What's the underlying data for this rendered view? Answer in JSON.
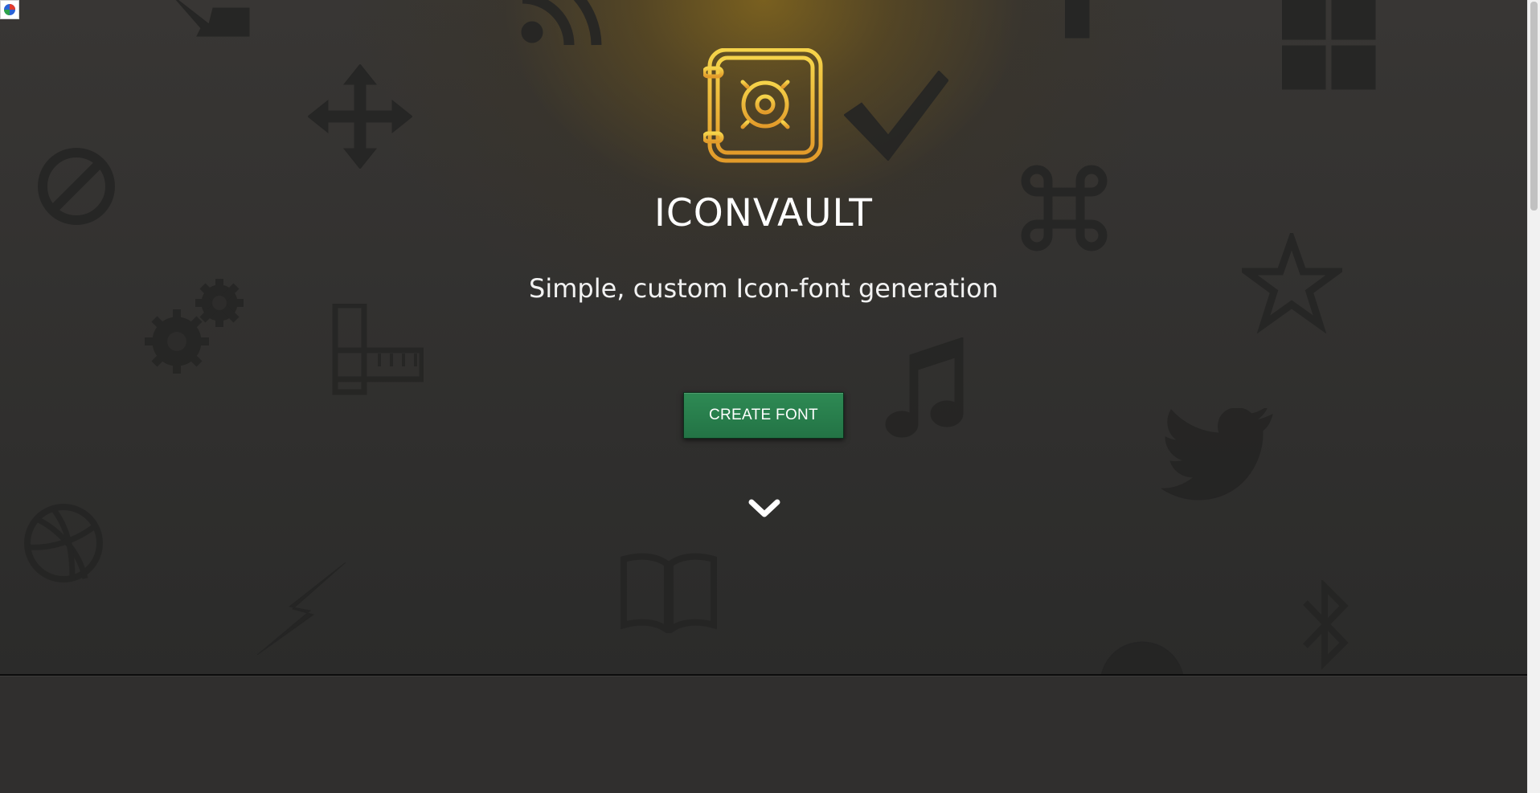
{
  "app": {
    "title": "ICONVAULT",
    "tagline": "Simple, custom Icon-font generation"
  },
  "actions": {
    "create_label": "CREATE FONT"
  },
  "colors": {
    "accent_gold": "#e8b63a",
    "button_green": "#2e8a54",
    "background": "#2b2b2a"
  },
  "background_icons": [
    "arrow-down-right-icon",
    "rss-icon",
    "windows-icon",
    "move-icon",
    "check-icon",
    "ban-icon",
    "command-icon",
    "star-icon",
    "gears-icon",
    "ruler-icon",
    "music-icon",
    "twitter-icon",
    "dribbble-icon",
    "bolt-icon",
    "book-icon",
    "bluetooth-icon",
    "globe-icon"
  ]
}
